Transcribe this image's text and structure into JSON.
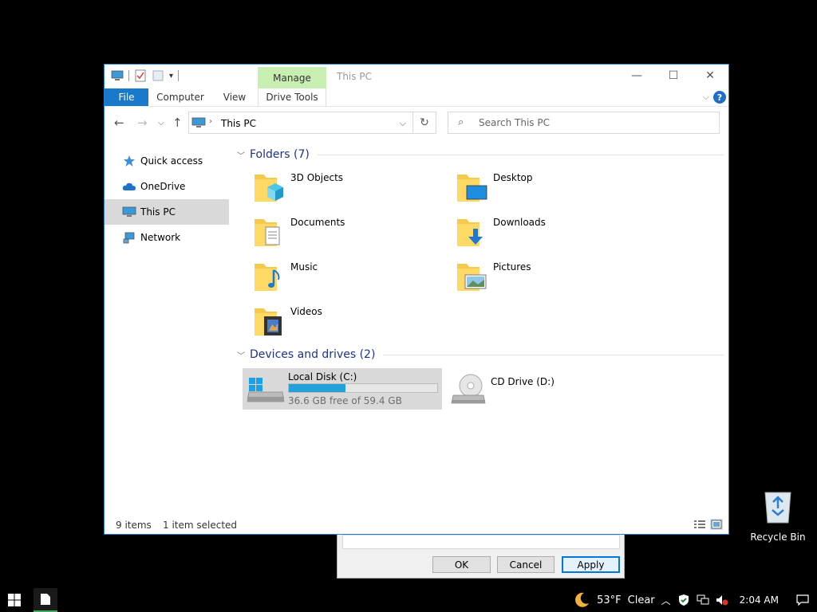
{
  "window": {
    "title": "This PC",
    "manage_tab": "Manage",
    "controls": {
      "minimize": "—",
      "maximize": "☐",
      "close": "✕"
    }
  },
  "ribbon": {
    "tabs": [
      {
        "label": "File"
      },
      {
        "label": "Computer"
      },
      {
        "label": "View"
      },
      {
        "label": "Drive Tools"
      }
    ],
    "help": "?"
  },
  "navbar": {
    "address": "This PC",
    "search_placeholder": "Search This PC"
  },
  "navpane": {
    "items": [
      {
        "label": "Quick access",
        "icon": "star-icon"
      },
      {
        "label": "OneDrive",
        "icon": "cloud-icon"
      },
      {
        "label": "This PC",
        "icon": "computer-icon",
        "selected": true
      },
      {
        "label": "Network",
        "icon": "network-icon"
      }
    ]
  },
  "content": {
    "folders_header": "Folders (7)",
    "folders": [
      {
        "name": "3D Objects",
        "icon": "3d-objects-icon"
      },
      {
        "name": "Desktop",
        "icon": "desktop-folder-icon"
      },
      {
        "name": "Documents",
        "icon": "documents-folder-icon"
      },
      {
        "name": "Downloads",
        "icon": "downloads-folder-icon"
      },
      {
        "name": "Music",
        "icon": "music-folder-icon"
      },
      {
        "name": "Pictures",
        "icon": "pictures-folder-icon"
      },
      {
        "name": "Videos",
        "icon": "videos-folder-icon"
      }
    ],
    "devices_header": "Devices and drives (2)",
    "drives": [
      {
        "name": "Local Disk (C:)",
        "free": "36.6 GB free of 59.4 GB",
        "used_fraction": 0.384,
        "selected": true
      },
      {
        "name": "CD Drive (D:)"
      }
    ]
  },
  "status": {
    "items": "9 items",
    "selected": "1 item selected"
  },
  "dialog": {
    "ok": "OK",
    "cancel": "Cancel",
    "apply": "Apply"
  },
  "desktop": {
    "recycle_bin": "Recycle Bin"
  },
  "taskbar": {
    "temperature": "53°F",
    "weather": "Clear",
    "time": "2:04 AM"
  },
  "colors": {
    "accent": "#1979ca",
    "manage_tab": "#c8efb1",
    "drive_fill": "#26a0da",
    "group_header": "#1e3287"
  }
}
